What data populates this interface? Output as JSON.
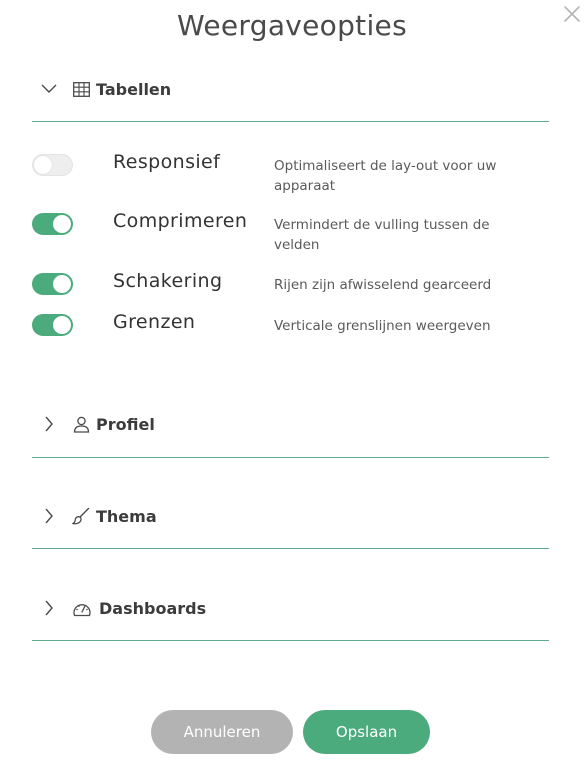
{
  "dialog": {
    "title": "Weergaveopties",
    "close_icon": "close-icon"
  },
  "colors": {
    "accent": "#4bab7d",
    "divider": "#5fae8d",
    "cancel": "#b3b3b3"
  },
  "sections": [
    {
      "label": "Tabellen",
      "icon": "table-icon",
      "expanded": true
    },
    {
      "label": "Profiel",
      "icon": "user-icon",
      "expanded": false
    },
    {
      "label": "Thema",
      "icon": "brush-icon",
      "expanded": false
    },
    {
      "label": "Dashboards",
      "icon": "gauge-icon",
      "expanded": false
    }
  ],
  "options": [
    {
      "label": "Responsief",
      "description": "Optimaliseert de lay-out voor uw apparaat",
      "enabled": false
    },
    {
      "label": "Comprimeren",
      "description": "Vermindert de vulling tussen de velden",
      "enabled": true
    },
    {
      "label": "Schakering",
      "description": "Rijen zijn afwisselend gearceerd",
      "enabled": true
    },
    {
      "label": "Grenzen",
      "description": "Verticale grenslijnen weergeven",
      "enabled": true
    }
  ],
  "buttons": {
    "cancel_label": "Annuleren",
    "save_label": "Opslaan"
  }
}
